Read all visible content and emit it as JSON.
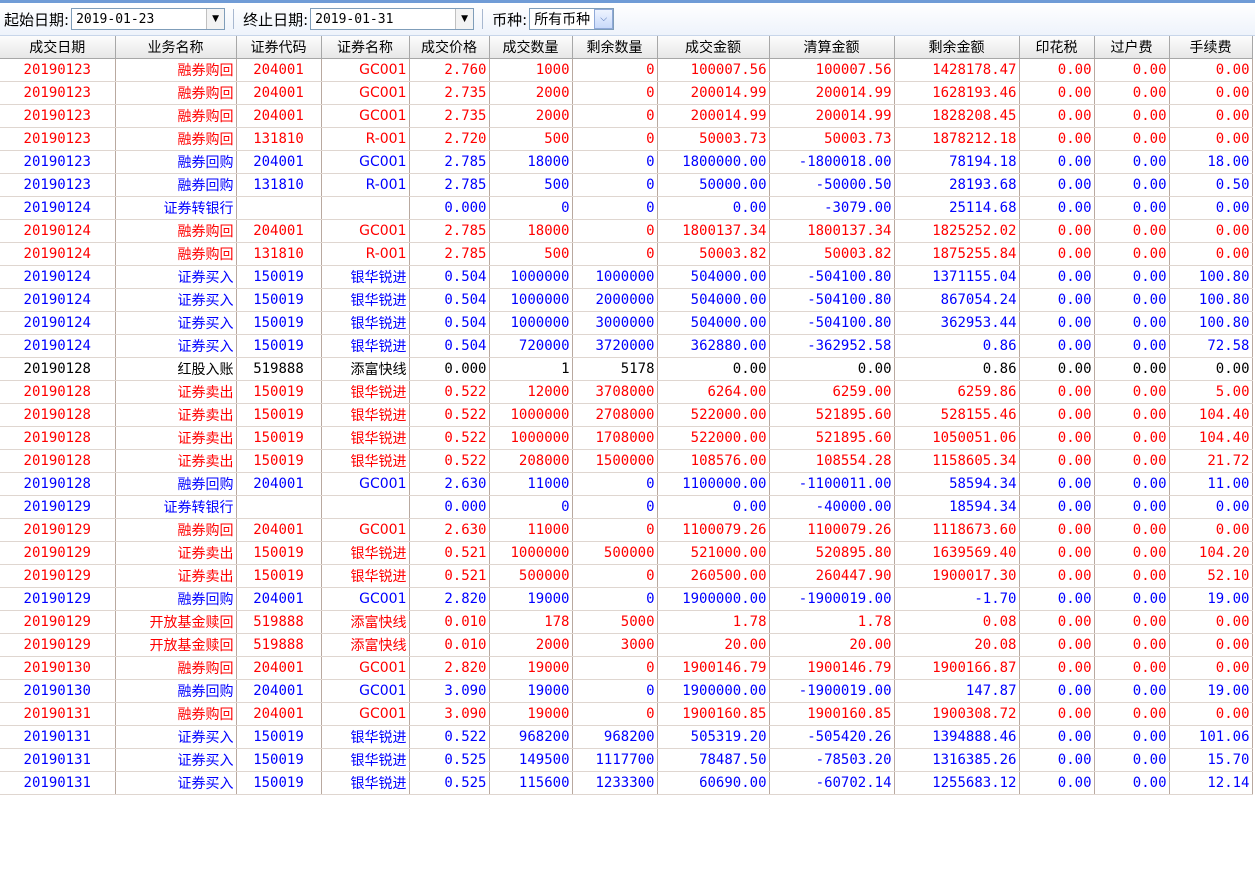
{
  "filter": {
    "start_label": "起始日期:",
    "start_value": "2019-01-23",
    "end_label": "终止日期:",
    "end_value": "2019-01-31",
    "currency_label": "币种:",
    "currency_value": "所有币种"
  },
  "columns": [
    "成交日期",
    "业务名称",
    "证券代码",
    "证券名称",
    "成交价格",
    "成交数量",
    "剩余数量",
    "成交金额",
    "清算金额",
    "剩余金额",
    "印花税",
    "过户费",
    "手续费"
  ],
  "colors": {
    "sell_or_repurchase": "#ff0000",
    "buy_or_lend": "#0000ff",
    "neutral": "#000000"
  },
  "rows": [
    {
      "color": "red",
      "cells": [
        "20190123",
        "融券购回",
        "204001",
        "GC001",
        "2.760",
        "1000",
        "0",
        "100007.56",
        "100007.56",
        "1428178.47",
        "0.00",
        "0.00",
        "0.00"
      ]
    },
    {
      "color": "red",
      "cells": [
        "20190123",
        "融券购回",
        "204001",
        "GC001",
        "2.735",
        "2000",
        "0",
        "200014.99",
        "200014.99",
        "1628193.46",
        "0.00",
        "0.00",
        "0.00"
      ]
    },
    {
      "color": "red",
      "cells": [
        "20190123",
        "融券购回",
        "204001",
        "GC001",
        "2.735",
        "2000",
        "0",
        "200014.99",
        "200014.99",
        "1828208.45",
        "0.00",
        "0.00",
        "0.00"
      ]
    },
    {
      "color": "red",
      "cells": [
        "20190123",
        "融券购回",
        "131810",
        "R-001",
        "2.720",
        "500",
        "0",
        "50003.73",
        "50003.73",
        "1878212.18",
        "0.00",
        "0.00",
        "0.00"
      ]
    },
    {
      "color": "blue",
      "cells": [
        "20190123",
        "融券回购",
        "204001",
        "GC001",
        "2.785",
        "18000",
        "0",
        "1800000.00",
        "-1800018.00",
        "78194.18",
        "0.00",
        "0.00",
        "18.00"
      ]
    },
    {
      "color": "blue",
      "cells": [
        "20190123",
        "融券回购",
        "131810",
        "R-001",
        "2.785",
        "500",
        "0",
        "50000.00",
        "-50000.50",
        "28193.68",
        "0.00",
        "0.00",
        "0.50"
      ]
    },
    {
      "color": "blue",
      "cells": [
        "20190124",
        "证券转银行",
        "",
        "",
        "0.000",
        "0",
        "0",
        "0.00",
        "-3079.00",
        "25114.68",
        "0.00",
        "0.00",
        "0.00"
      ]
    },
    {
      "color": "red",
      "cells": [
        "20190124",
        "融券购回",
        "204001",
        "GC001",
        "2.785",
        "18000",
        "0",
        "1800137.34",
        "1800137.34",
        "1825252.02",
        "0.00",
        "0.00",
        "0.00"
      ]
    },
    {
      "color": "red",
      "cells": [
        "20190124",
        "融券购回",
        "131810",
        "R-001",
        "2.785",
        "500",
        "0",
        "50003.82",
        "50003.82",
        "1875255.84",
        "0.00",
        "0.00",
        "0.00"
      ]
    },
    {
      "color": "blue",
      "cells": [
        "20190124",
        "证券买入",
        "150019",
        "银华锐进",
        "0.504",
        "1000000",
        "1000000",
        "504000.00",
        "-504100.80",
        "1371155.04",
        "0.00",
        "0.00",
        "100.80"
      ]
    },
    {
      "color": "blue",
      "cells": [
        "20190124",
        "证券买入",
        "150019",
        "银华锐进",
        "0.504",
        "1000000",
        "2000000",
        "504000.00",
        "-504100.80",
        "867054.24",
        "0.00",
        "0.00",
        "100.80"
      ]
    },
    {
      "color": "blue",
      "cells": [
        "20190124",
        "证券买入",
        "150019",
        "银华锐进",
        "0.504",
        "1000000",
        "3000000",
        "504000.00",
        "-504100.80",
        "362953.44",
        "0.00",
        "0.00",
        "100.80"
      ]
    },
    {
      "color": "blue",
      "cells": [
        "20190124",
        "证券买入",
        "150019",
        "银华锐进",
        "0.504",
        "720000",
        "3720000",
        "362880.00",
        "-362952.58",
        "0.86",
        "0.00",
        "0.00",
        "72.58"
      ]
    },
    {
      "color": "black",
      "cells": [
        "20190128",
        "红股入账",
        "519888",
        "添富快线",
        "0.000",
        "1",
        "5178",
        "0.00",
        "0.00",
        "0.86",
        "0.00",
        "0.00",
        "0.00"
      ]
    },
    {
      "color": "red",
      "cells": [
        "20190128",
        "证券卖出",
        "150019",
        "银华锐进",
        "0.522",
        "12000",
        "3708000",
        "6264.00",
        "6259.00",
        "6259.86",
        "0.00",
        "0.00",
        "5.00"
      ]
    },
    {
      "color": "red",
      "cells": [
        "20190128",
        "证券卖出",
        "150019",
        "银华锐进",
        "0.522",
        "1000000",
        "2708000",
        "522000.00",
        "521895.60",
        "528155.46",
        "0.00",
        "0.00",
        "104.40"
      ]
    },
    {
      "color": "red",
      "cells": [
        "20190128",
        "证券卖出",
        "150019",
        "银华锐进",
        "0.522",
        "1000000",
        "1708000",
        "522000.00",
        "521895.60",
        "1050051.06",
        "0.00",
        "0.00",
        "104.40"
      ]
    },
    {
      "color": "red",
      "cells": [
        "20190128",
        "证券卖出",
        "150019",
        "银华锐进",
        "0.522",
        "208000",
        "1500000",
        "108576.00",
        "108554.28",
        "1158605.34",
        "0.00",
        "0.00",
        "21.72"
      ]
    },
    {
      "color": "blue",
      "cells": [
        "20190128",
        "融券回购",
        "204001",
        "GC001",
        "2.630",
        "11000",
        "0",
        "1100000.00",
        "-1100011.00",
        "58594.34",
        "0.00",
        "0.00",
        "11.00"
      ]
    },
    {
      "color": "blue",
      "cells": [
        "20190129",
        "证券转银行",
        "",
        "",
        "0.000",
        "0",
        "0",
        "0.00",
        "-40000.00",
        "18594.34",
        "0.00",
        "0.00",
        "0.00"
      ]
    },
    {
      "color": "red",
      "cells": [
        "20190129",
        "融券购回",
        "204001",
        "GC001",
        "2.630",
        "11000",
        "0",
        "1100079.26",
        "1100079.26",
        "1118673.60",
        "0.00",
        "0.00",
        "0.00"
      ]
    },
    {
      "color": "red",
      "cells": [
        "20190129",
        "证券卖出",
        "150019",
        "银华锐进",
        "0.521",
        "1000000",
        "500000",
        "521000.00",
        "520895.80",
        "1639569.40",
        "0.00",
        "0.00",
        "104.20"
      ]
    },
    {
      "color": "red",
      "cells": [
        "20190129",
        "证券卖出",
        "150019",
        "银华锐进",
        "0.521",
        "500000",
        "0",
        "260500.00",
        "260447.90",
        "1900017.30",
        "0.00",
        "0.00",
        "52.10"
      ]
    },
    {
      "color": "blue",
      "cells": [
        "20190129",
        "融券回购",
        "204001",
        "GC001",
        "2.820",
        "19000",
        "0",
        "1900000.00",
        "-1900019.00",
        "-1.70",
        "0.00",
        "0.00",
        "19.00"
      ]
    },
    {
      "color": "red",
      "cells": [
        "20190129",
        "开放基金赎回",
        "519888",
        "添富快线",
        "0.010",
        "178",
        "5000",
        "1.78",
        "1.78",
        "0.08",
        "0.00",
        "0.00",
        "0.00"
      ]
    },
    {
      "color": "red",
      "cells": [
        "20190129",
        "开放基金赎回",
        "519888",
        "添富快线",
        "0.010",
        "2000",
        "3000",
        "20.00",
        "20.00",
        "20.08",
        "0.00",
        "0.00",
        "0.00"
      ]
    },
    {
      "color": "red",
      "cells": [
        "20190130",
        "融券购回",
        "204001",
        "GC001",
        "2.820",
        "19000",
        "0",
        "1900146.79",
        "1900146.79",
        "1900166.87",
        "0.00",
        "0.00",
        "0.00"
      ]
    },
    {
      "color": "blue",
      "cells": [
        "20190130",
        "融券回购",
        "204001",
        "GC001",
        "3.090",
        "19000",
        "0",
        "1900000.00",
        "-1900019.00",
        "147.87",
        "0.00",
        "0.00",
        "19.00"
      ]
    },
    {
      "color": "red",
      "cells": [
        "20190131",
        "融券购回",
        "204001",
        "GC001",
        "3.090",
        "19000",
        "0",
        "1900160.85",
        "1900160.85",
        "1900308.72",
        "0.00",
        "0.00",
        "0.00"
      ]
    },
    {
      "color": "blue",
      "cells": [
        "20190131",
        "证券买入",
        "150019",
        "银华锐进",
        "0.522",
        "968200",
        "968200",
        "505319.20",
        "-505420.26",
        "1394888.46",
        "0.00",
        "0.00",
        "101.06"
      ]
    },
    {
      "color": "blue",
      "cells": [
        "20190131",
        "证券买入",
        "150019",
        "银华锐进",
        "0.525",
        "149500",
        "1117700",
        "78487.50",
        "-78503.20",
        "1316385.26",
        "0.00",
        "0.00",
        "15.70"
      ]
    },
    {
      "color": "blue",
      "cells": [
        "20190131",
        "证券买入",
        "150019",
        "银华锐进",
        "0.525",
        "115600",
        "1233300",
        "60690.00",
        "-60702.14",
        "1255683.12",
        "0.00",
        "0.00",
        "12.14"
      ]
    }
  ]
}
